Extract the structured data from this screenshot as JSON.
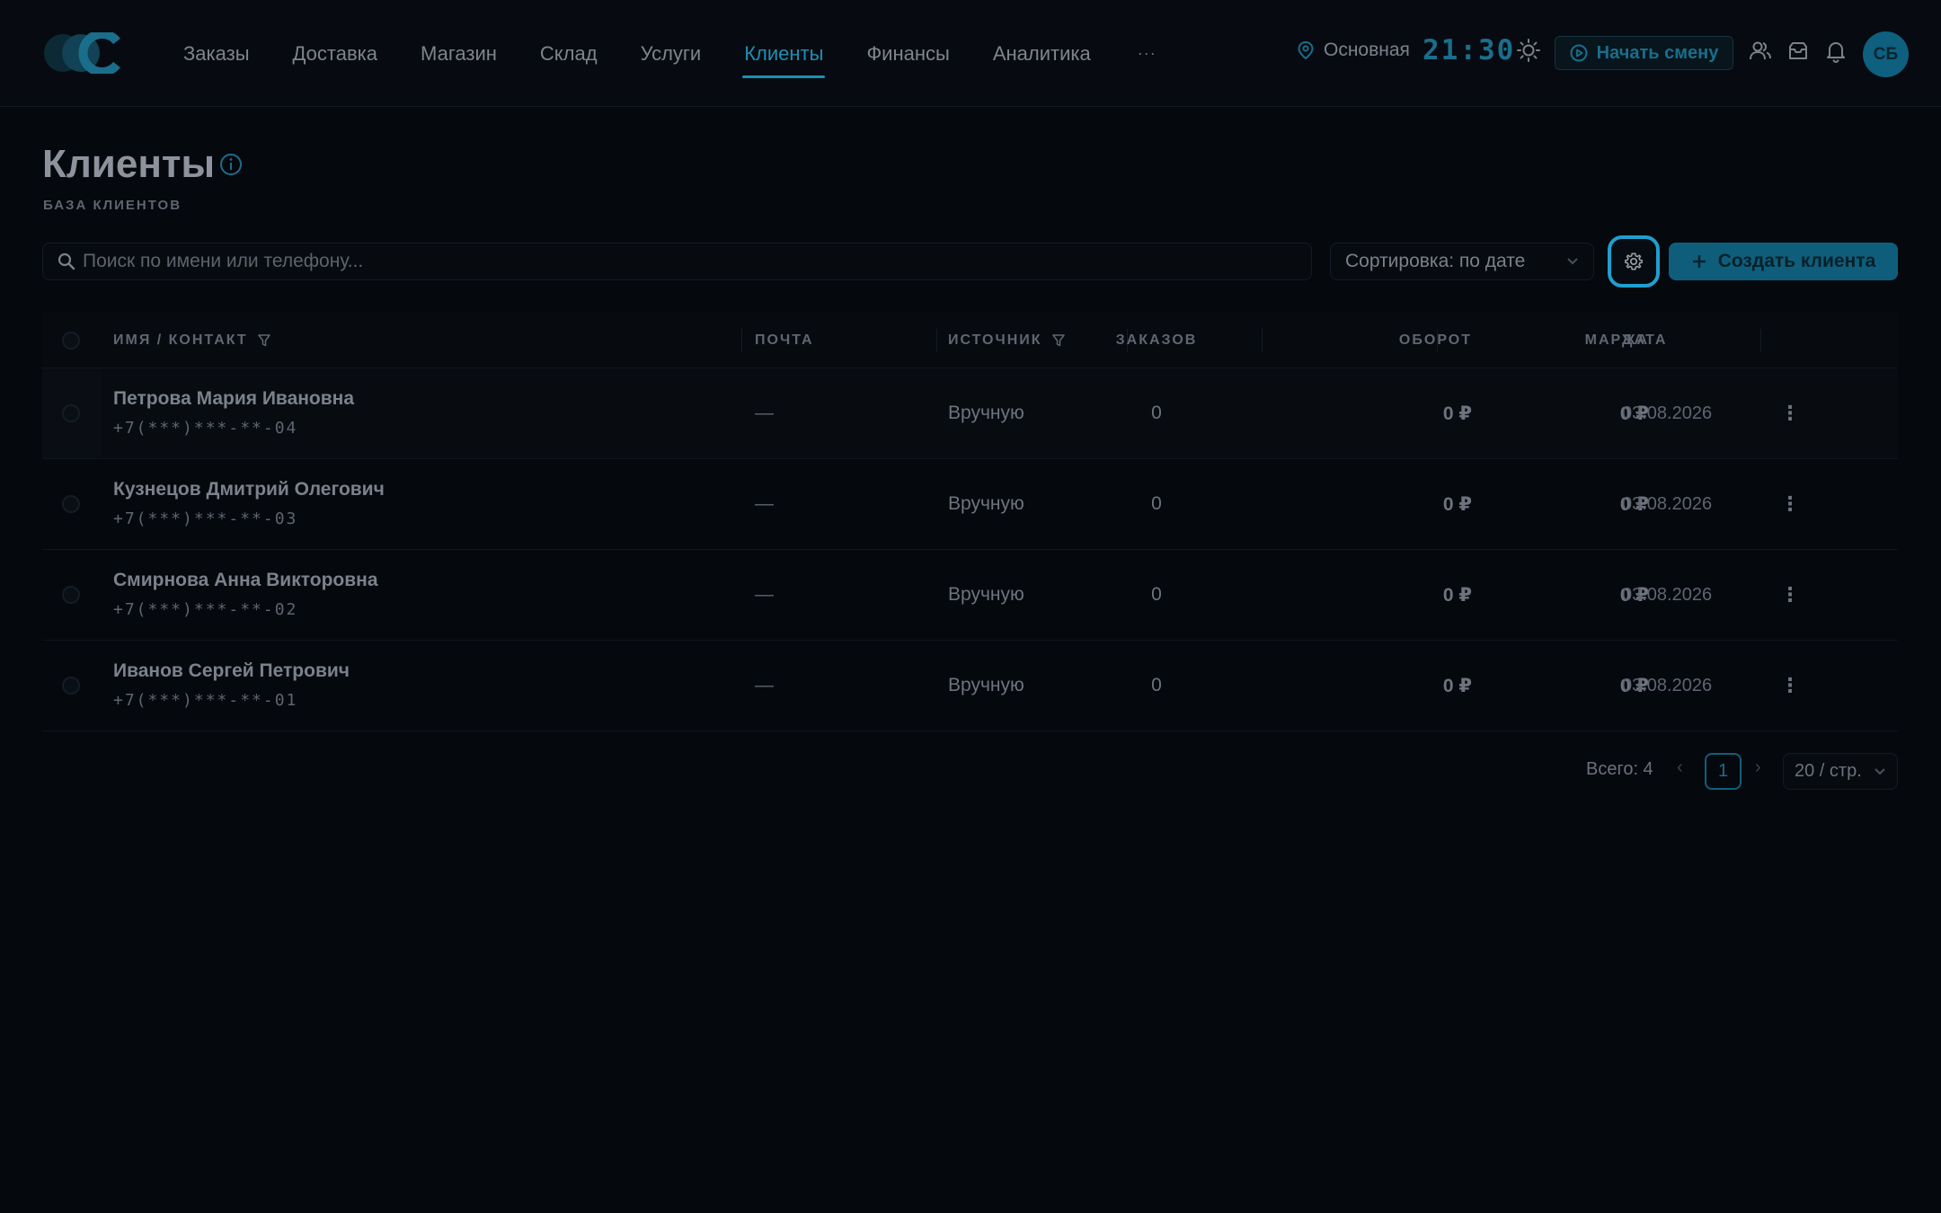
{
  "header": {
    "nav": [
      {
        "label": "Заказы",
        "active": false
      },
      {
        "label": "Доставка",
        "active": false
      },
      {
        "label": "Магазин",
        "active": false
      },
      {
        "label": "Склад",
        "active": false
      },
      {
        "label": "Услуги",
        "active": false
      },
      {
        "label": "Клиенты",
        "active": true
      },
      {
        "label": "Финансы",
        "active": false
      },
      {
        "label": "Аналитика",
        "active": false
      }
    ],
    "more_label": "···",
    "branch": "Основная",
    "clock": "21:30",
    "shift_button": "Начать смену",
    "avatar_initials": "СБ",
    "accent_color": "#1f8fb2"
  },
  "page": {
    "title": "Клиенты",
    "subtitle": "БАЗА КЛИЕНТОВ"
  },
  "toolbar": {
    "search_placeholder": "Поиск по имени или телефону...",
    "sort_label": "Сортировка: по дате",
    "create_button": "Создать клиента"
  },
  "table": {
    "columns": {
      "name": "ИМЯ / КОНТАКТ",
      "email": "ПОЧТА",
      "source": "ИСТОЧНИК",
      "orders": "ЗАКАЗОВ",
      "turnover": "ОБОРОТ",
      "margin": "МАРЖА",
      "date": "ДАТА"
    },
    "rows": [
      {
        "name": "Петрова Мария Ивановна",
        "phone": "+7(***)***-**-04",
        "email": "—",
        "source": "Вручную",
        "orders": "0",
        "turnover": "0 ₽",
        "margin": "0 ₽",
        "date": "03.08.2026"
      },
      {
        "name": "Кузнецов Дмитрий Олегович",
        "phone": "+7(***)***-**-03",
        "email": "—",
        "source": "Вручную",
        "orders": "0",
        "turnover": "0 ₽",
        "margin": "0 ₽",
        "date": "03.08.2026"
      },
      {
        "name": "Смирнова Анна Викторовна",
        "phone": "+7(***)***-**-02",
        "email": "—",
        "source": "Вручную",
        "orders": "0",
        "turnover": "0 ₽",
        "margin": "0 ₽",
        "date": "03.08.2026"
      },
      {
        "name": "Иванов Сергей Петрович",
        "phone": "+7(***)***-**-01",
        "email": "—",
        "source": "Вручную",
        "orders": "0",
        "turnover": "0 ₽",
        "margin": "0 ₽",
        "date": "03.08.2026"
      }
    ]
  },
  "pagination": {
    "total": "Всего: 4",
    "current_page": "1",
    "per_page": "20 / стр.",
    "prev": "‹",
    "next": "›"
  }
}
